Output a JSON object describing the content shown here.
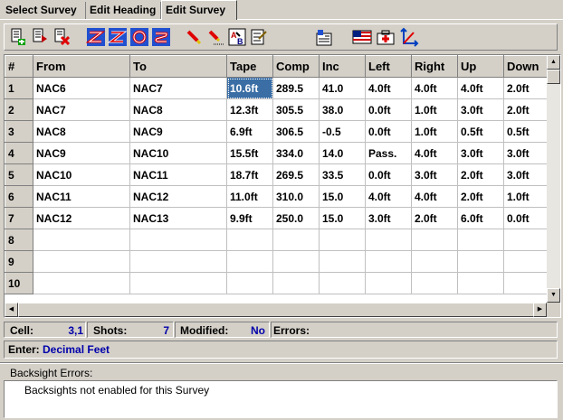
{
  "tabs": [
    {
      "label": "Select Survey",
      "active": false
    },
    {
      "label": "Edit Heading",
      "active": false
    },
    {
      "label": "Edit Survey",
      "active": true
    }
  ],
  "toolbar": {
    "buttons": [
      "add-row-icon",
      "insert-row-icon",
      "delete-row-icon",
      "reverse-shot-icon",
      "reverse-all-icon",
      "convert-icon",
      "refresh-icon",
      "pen-icon",
      "pen-clear-icon",
      "spell-ab-icon",
      "checklist-icon",
      "report-icon",
      "flag-icon",
      "medical-kit-icon",
      "axis-icon"
    ]
  },
  "grid": {
    "columns": [
      "#",
      "From",
      "To",
      "Tape",
      "Comp",
      "Inc",
      "Left",
      "Right",
      "Up",
      "Down"
    ],
    "rows": [
      [
        "1",
        "NAC6",
        "NAC7",
        "10.6ft",
        "289.5",
        "41.0",
        "4.0ft",
        "4.0ft",
        "4.0ft",
        "2.0ft"
      ],
      [
        "2",
        "NAC7",
        "NAC8",
        "12.3ft",
        "305.5",
        "38.0",
        "0.0ft",
        "1.0ft",
        "3.0ft",
        "2.0ft"
      ],
      [
        "3",
        "NAC8",
        "NAC9",
        "6.9ft",
        "306.5",
        "-0.5",
        "0.0ft",
        "1.0ft",
        "0.5ft",
        "0.5ft"
      ],
      [
        "4",
        "NAC9",
        "NAC10",
        "15.5ft",
        "334.0",
        "14.0",
        "Pass.",
        "4.0ft",
        "3.0ft",
        "3.0ft"
      ],
      [
        "5",
        "NAC10",
        "NAC11",
        "18.7ft",
        "269.5",
        "33.5",
        "0.0ft",
        "3.0ft",
        "2.0ft",
        "3.0ft"
      ],
      [
        "6",
        "NAC11",
        "NAC12",
        "11.0ft",
        "310.0",
        "15.0",
        "4.0ft",
        "4.0ft",
        "2.0ft",
        "1.0ft"
      ],
      [
        "7",
        "NAC12",
        "NAC13",
        "9.9ft",
        "250.0",
        "15.0",
        "3.0ft",
        "2.0ft",
        "6.0ft",
        "0.0ft"
      ],
      [
        "8",
        "",
        "",
        "",
        "",
        "",
        "",
        "",
        "",
        ""
      ],
      [
        "9",
        "",
        "",
        "",
        "",
        "",
        "",
        "",
        "",
        ""
      ],
      [
        "10",
        "",
        "",
        "",
        "",
        "",
        "",
        "",
        "",
        ""
      ]
    ],
    "selected_row": 1,
    "selected_col": 3,
    "selection_color": "#3a6ea5"
  },
  "status": {
    "cell_label": "Cell:",
    "cell_value": "3,1",
    "shots_label": "Shots:",
    "shots_value": "7",
    "modified_label": "Modified:",
    "modified_value": "No",
    "errors_label": "Errors:"
  },
  "enter": {
    "label": "Enter:",
    "value": "Decimal Feet"
  },
  "backsight": {
    "label": "Backsight Errors:",
    "message": "Backsights not enabled for this Survey"
  }
}
